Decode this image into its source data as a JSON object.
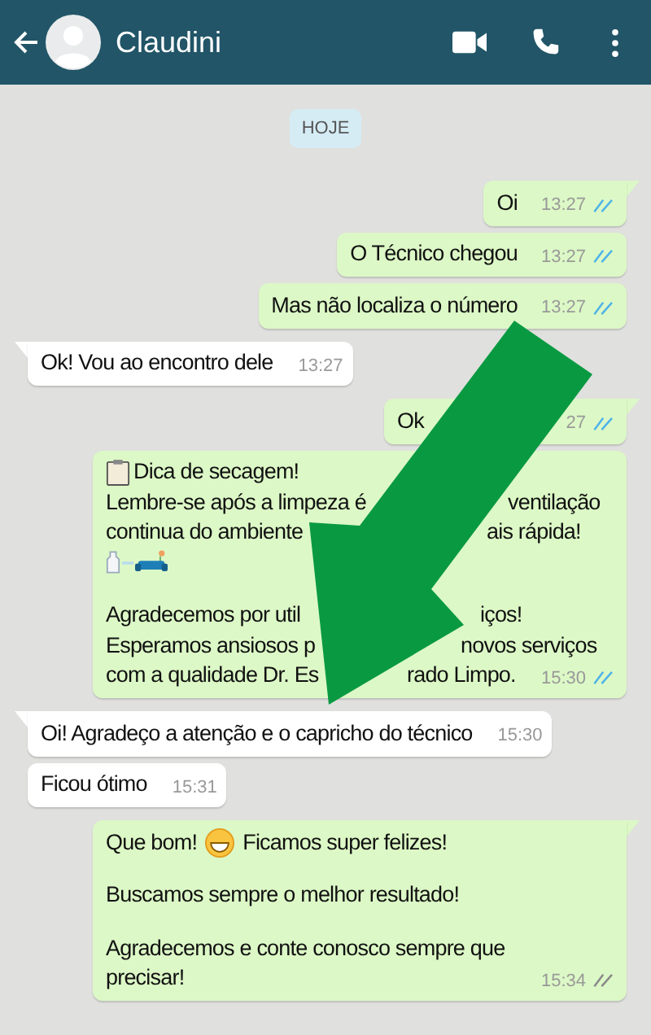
{
  "header": {
    "contact_name": "Claudini"
  },
  "date_chip": "HOJE",
  "messages": [
    {
      "kind": "text",
      "outgoing": true,
      "tail": true,
      "text": "Oi",
      "time": "13:27",
      "read": true
    },
    {
      "kind": "text",
      "outgoing": true,
      "tail": false,
      "text": "O Técnico chegou",
      "time": "13:27",
      "read": true
    },
    {
      "kind": "text",
      "outgoing": true,
      "tail": false,
      "text": "Mas não localiza o número",
      "time": "13:27",
      "read": true
    },
    {
      "kind": "text",
      "outgoing": false,
      "tail": true,
      "text": "Ok! Vou ao encontro dele",
      "time": "13:27"
    },
    {
      "kind": "rich",
      "outgoing": true,
      "tail": true,
      "time": "27",
      "read": true,
      "lines": [
        {
          "kind": "split",
          "left": "Ok"
        }
      ]
    },
    {
      "kind": "rich",
      "outgoing": true,
      "tail": false,
      "time": "15:30",
      "read": true,
      "lines": [
        {
          "kind": "heading",
          "text": "Dica de secagem!"
        },
        {
          "kind": "split",
          "left": "Lembre-se após a limpeza é",
          "right": "ventilação"
        },
        {
          "kind": "split",
          "left": "continua do ambiente",
          "right": "ais rápida!"
        },
        {
          "kind": "icons"
        },
        {
          "kind": "blank"
        },
        {
          "kind": "split",
          "left": "Agradecemos por util",
          "right": "iços!"
        },
        {
          "kind": "split",
          "left": "Esperamos ansiosos p",
          "right": "novos serviços"
        },
        {
          "kind": "split",
          "left": "com a qualidade Dr. Es",
          "right": "rado Limpo."
        }
      ]
    },
    {
      "kind": "text",
      "outgoing": false,
      "tail": true,
      "text": "Oi! Agradeço a atenção e o capricho do técnico",
      "time": "15:30"
    },
    {
      "kind": "text",
      "outgoing": false,
      "tail": false,
      "text": "Ficou ótimo",
      "time": "15:31"
    },
    {
      "kind": "rich",
      "outgoing": true,
      "tail": true,
      "time": "15:34",
      "read": false,
      "lines": [
        {
          "kind": "emoji",
          "left": "Que bom!",
          "right": "Ficamos super felizes!"
        },
        {
          "kind": "blank"
        },
        {
          "kind": "text",
          "text": "Buscamos sempre o melhor resultado!"
        },
        {
          "kind": "blank"
        },
        {
          "kind": "text",
          "text": "Agradecemos e conte conosco sempre que"
        },
        {
          "kind": "text",
          "text": "precisar!"
        }
      ]
    }
  ]
}
